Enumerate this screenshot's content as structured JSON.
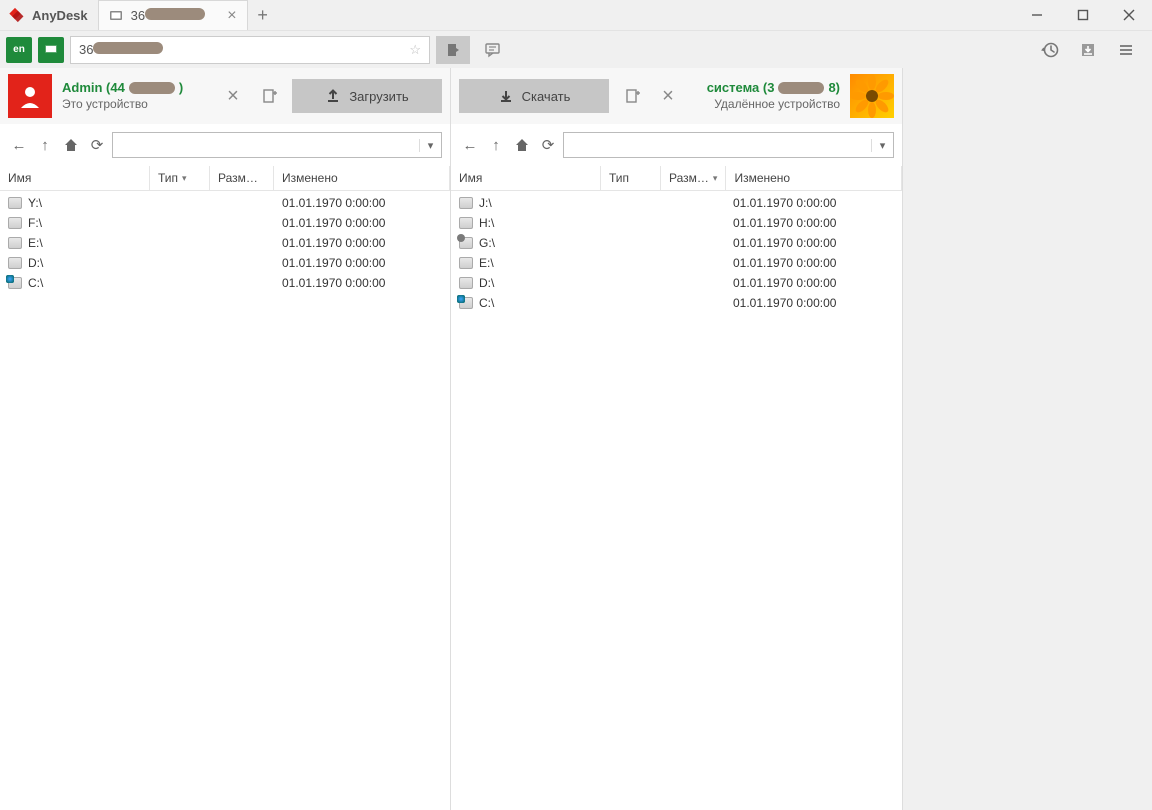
{
  "app": {
    "name": "AnyDesk"
  },
  "tab": {
    "title_prefix": "36"
  },
  "address": {
    "text_prefix": "36"
  },
  "local": {
    "title_prefix": "Admin (44",
    "title_suffix": ")",
    "subtitle": "Это устройство",
    "upload_label": "Загрузить",
    "columns": {
      "name": "Имя",
      "type": "Тип",
      "size": "Разм…",
      "modified": "Изменено"
    },
    "drives": [
      {
        "name": "Y:\\",
        "kind": "hdd",
        "modified": "01.01.1970 0:00:00"
      },
      {
        "name": "F:\\",
        "kind": "hdd",
        "modified": "01.01.1970 0:00:00"
      },
      {
        "name": "E:\\",
        "kind": "hdd",
        "modified": "01.01.1970 0:00:00"
      },
      {
        "name": "D:\\",
        "kind": "hdd",
        "modified": "01.01.1970 0:00:00"
      },
      {
        "name": "C:\\",
        "kind": "sys",
        "modified": "01.01.1970 0:00:00"
      }
    ]
  },
  "remote": {
    "title_prefix": "система (3",
    "title_suffix": "8)",
    "subtitle": "Удалённое устройство",
    "download_label": "Скачать",
    "columns": {
      "name": "Имя",
      "type": "Тип",
      "size": "Разм…",
      "modified": "Изменено"
    },
    "drives": [
      {
        "name": "J:\\",
        "kind": "hdd",
        "modified": "01.01.1970 0:00:00"
      },
      {
        "name": "H:\\",
        "kind": "hdd",
        "modified": "01.01.1970 0:00:00"
      },
      {
        "name": "G:\\",
        "kind": "usb",
        "modified": "01.01.1970 0:00:00"
      },
      {
        "name": "E:\\",
        "kind": "hdd",
        "modified": "01.01.1970 0:00:00"
      },
      {
        "name": "D:\\",
        "kind": "hdd",
        "modified": "01.01.1970 0:00:00"
      },
      {
        "name": "C:\\",
        "kind": "sys",
        "modified": "01.01.1970 0:00:00"
      }
    ]
  }
}
